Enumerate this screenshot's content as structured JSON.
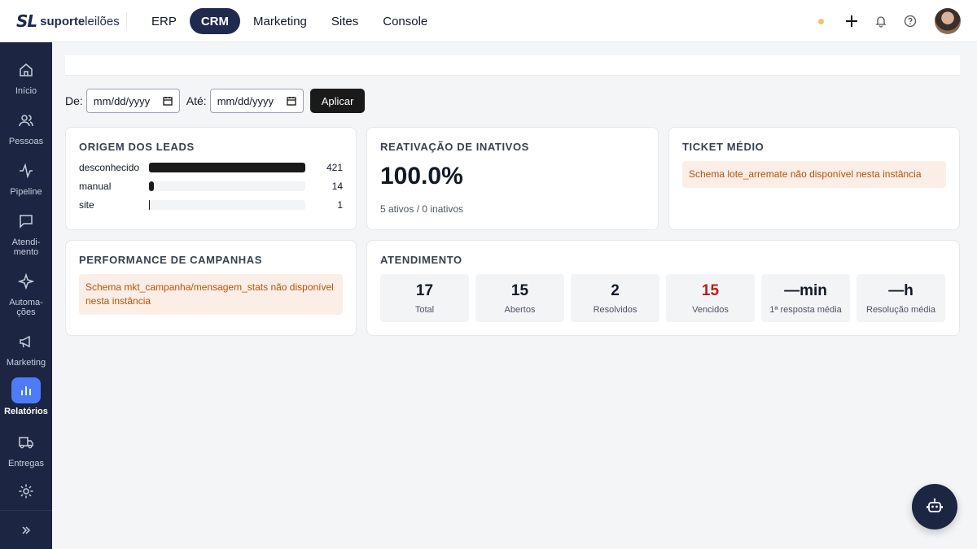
{
  "brand": {
    "mark": "SL",
    "name_bold": "suporte",
    "name_light": "leilões"
  },
  "nav": [
    {
      "label": "ERP",
      "active": false
    },
    {
      "label": "CRM",
      "active": true
    },
    {
      "label": "Marketing",
      "active": false
    },
    {
      "label": "Sites",
      "active": false
    },
    {
      "label": "Console",
      "active": false
    }
  ],
  "topbar_icons": [
    "status-dot",
    "plus-icon",
    "bell-icon",
    "help-icon",
    "avatar"
  ],
  "sidebar": [
    {
      "label": "Início",
      "icon": "home-icon"
    },
    {
      "label": "Pessoas",
      "icon": "people-icon"
    },
    {
      "label": "Pipeline",
      "icon": "pipeline-icon"
    },
    {
      "label": "Atendi-\nmento",
      "icon": "chat-icon"
    },
    {
      "label": "Automa-\nções",
      "icon": "sparkle-icon"
    },
    {
      "label": "Marketing",
      "icon": "megaphone-icon"
    },
    {
      "label": "Relatórios",
      "icon": "bar-chart-icon",
      "active": true
    },
    {
      "label": "Entregas",
      "icon": "truck-icon"
    },
    {
      "label": "",
      "icon": "gear-icon"
    }
  ],
  "filters": {
    "from_label": "De:",
    "to_label": "Até:",
    "from_placeholder": "mm/dd/yyyy",
    "to_placeholder": "mm/dd/yyyy",
    "apply_label": "Aplicar"
  },
  "leads": {
    "title": "ORIGEM DOS LEADS",
    "rows": [
      {
        "name": "desconhecido",
        "value": 421,
        "fraction": 1.0
      },
      {
        "name": "manual",
        "value": 14,
        "fraction": 0.033
      },
      {
        "name": "site",
        "value": 1,
        "fraction": 0.002
      }
    ]
  },
  "reactivation": {
    "title": "REATIVAÇÃO DE INATIVOS",
    "value": "100.0%",
    "sub": "5 ativos / 0 inativos"
  },
  "ticket": {
    "title": "TICKET MÉDIO",
    "warning": "Schema lote_arremate não disponível nesta instância"
  },
  "campaigns": {
    "title": "PERFORMANCE DE CAMPANHAS",
    "warning": "Schema mkt_campanha/mensagem_stats não disponível nesta instância"
  },
  "support": {
    "title": "ATENDIMENTO",
    "stats": [
      {
        "value": "17",
        "label": "Total"
      },
      {
        "value": "15",
        "label": "Abertos"
      },
      {
        "value": "2",
        "label": "Resolvidos"
      },
      {
        "value": "15",
        "label": "Vencidos",
        "highlight": "#b91c1c"
      },
      {
        "value": "—min",
        "label": "1ª resposta média"
      },
      {
        "value": "—h",
        "label": "Resolução média"
      }
    ]
  },
  "assistant_icon": "robot-icon"
}
